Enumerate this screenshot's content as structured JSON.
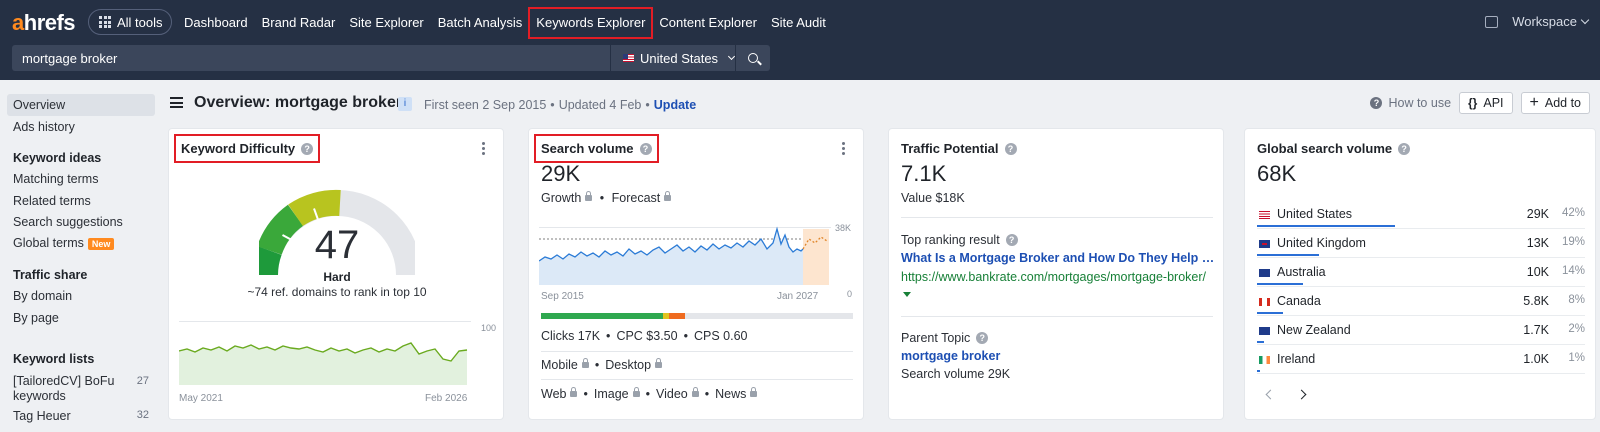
{
  "app": {
    "logo": "ahrefs"
  },
  "nav": {
    "all_tools": "All tools",
    "items": [
      "Dashboard",
      "Brand Radar",
      "Site Explorer",
      "Batch Analysis",
      "Keywords Explorer",
      "Content Explorer",
      "Site Audit"
    ],
    "active": "Keywords Explorer",
    "workspace": "Workspace"
  },
  "search": {
    "value": "mortgage broker",
    "country": "United States"
  },
  "sidebar": {
    "overview": "Overview",
    "ads_history": "Ads history",
    "keyword_ideas": "Keyword ideas",
    "matching_terms": "Matching terms",
    "related_terms": "Related terms",
    "search_suggestions": "Search suggestions",
    "global_terms": "Global terms",
    "new_badge": "New",
    "traffic_share": "Traffic share",
    "by_domain": "By domain",
    "by_page": "By page",
    "keyword_lists": "Keyword lists",
    "list1_name": "[TailoredCV] BoFu keywords",
    "list1_count": "27",
    "list2_name": "Tag Heuer",
    "list2_count": "32"
  },
  "header": {
    "title": "Overview: mortgage broker",
    "info": "i",
    "first_seen": "First seen 2 Sep 2015",
    "updated": "Updated 4 Feb",
    "update_link": "Update",
    "how_to_use": "How to use",
    "api": "API",
    "add_to": "Add to"
  },
  "kd_card": {
    "title": "Keyword Difficulty",
    "value": "47",
    "label": "Hard",
    "sub": "~74 ref. domains to rank in top 10",
    "chart_start": "May 2021",
    "chart_end": "Feb 2026",
    "y_max": "100",
    "y_min": "0"
  },
  "sv_card": {
    "title": "Search volume",
    "value": "29K",
    "growth": "Growth",
    "forecast": "Forecast",
    "chart_start": "Sep 2015",
    "chart_end": "Jan 2027",
    "y_max": "38K",
    "y_min": "0",
    "clicks": "Clicks 17K",
    "cpc": "CPC $3.50",
    "cps": "CPS 0.60",
    "mobile": "Mobile",
    "desktop": "Desktop",
    "web": "Web",
    "image": "Image",
    "video": "Video",
    "news": "News"
  },
  "tp_card": {
    "title": "Traffic Potential",
    "value": "7.1K",
    "value_usd": "Value $18K",
    "top_ranking_label": "Top ranking result",
    "top_result_title": "What Is a Mortgage Broker and How Do They Help …",
    "top_result_url": "https://www.bankrate.com/mortgages/mortgage-broker/",
    "parent_topic_label": "Parent Topic",
    "parent_topic": "mortgage broker",
    "parent_volume": "Search volume 29K"
  },
  "gsv_card": {
    "title": "Global search volume",
    "value": "68K",
    "countries": [
      {
        "name": "United States",
        "volume": "29K",
        "pct": "42%",
        "share": 42,
        "flag": "us"
      },
      {
        "name": "United Kingdom",
        "volume": "13K",
        "pct": "19%",
        "share": 19,
        "flag": "uk"
      },
      {
        "name": "Australia",
        "volume": "10K",
        "pct": "14%",
        "share": 14,
        "flag": "au"
      },
      {
        "name": "Canada",
        "volume": "5.8K",
        "pct": "8%",
        "share": 8,
        "flag": "ca"
      },
      {
        "name": "New Zealand",
        "volume": "1.7K",
        "pct": "2%",
        "share": 2,
        "flag": "nz"
      },
      {
        "name": "Ireland",
        "volume": "1.0K",
        "pct": "1%",
        "share": 1,
        "flag": "ie"
      }
    ]
  }
}
